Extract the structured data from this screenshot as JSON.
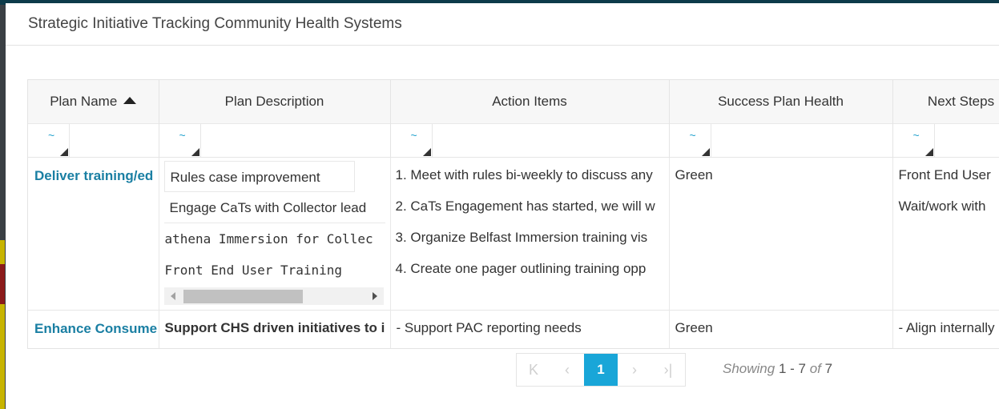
{
  "modal": {
    "title": "Strategic Initiative Tracking Community Health Systems"
  },
  "columns": [
    "Plan Name",
    "Plan Description",
    "Action Items",
    "Success Plan Health",
    "Next Steps"
  ],
  "rows": [
    {
      "plan_name": "Deliver training/ed",
      "descriptions": [
        "Rules case improvement",
        "Engage CaTs with Collector lead",
        "athena Immersion for Collec",
        "Front End User Training"
      ],
      "actions": [
        "1. Meet with rules bi-weekly to discuss any",
        "2. CaTs Engagement has started, we will w",
        "3. Organize Belfast Immersion training vis",
        "4. Create one pager outlining training opp"
      ],
      "health": "Green",
      "next_steps": [
        "Front End User",
        "Wait/work with"
      ]
    },
    {
      "plan_name": "Enhance Consume",
      "description": "Support CHS driven initiatives to i",
      "action": "- Support PAC reporting needs",
      "health": "Green",
      "next_step": "- Align internally"
    }
  ],
  "pagination": {
    "current_page": "1",
    "showing_label": "Showing",
    "range": "1 - 7",
    "of_label": "of",
    "total": "7"
  },
  "colors": {
    "accent": "#19a6d8",
    "link": "#1a7fa3"
  },
  "icons": [
    "filter-tilde-icon",
    "sort-ascending-icon",
    "first-page-icon",
    "prev-page-icon",
    "next-page-icon",
    "last-page-icon"
  ]
}
